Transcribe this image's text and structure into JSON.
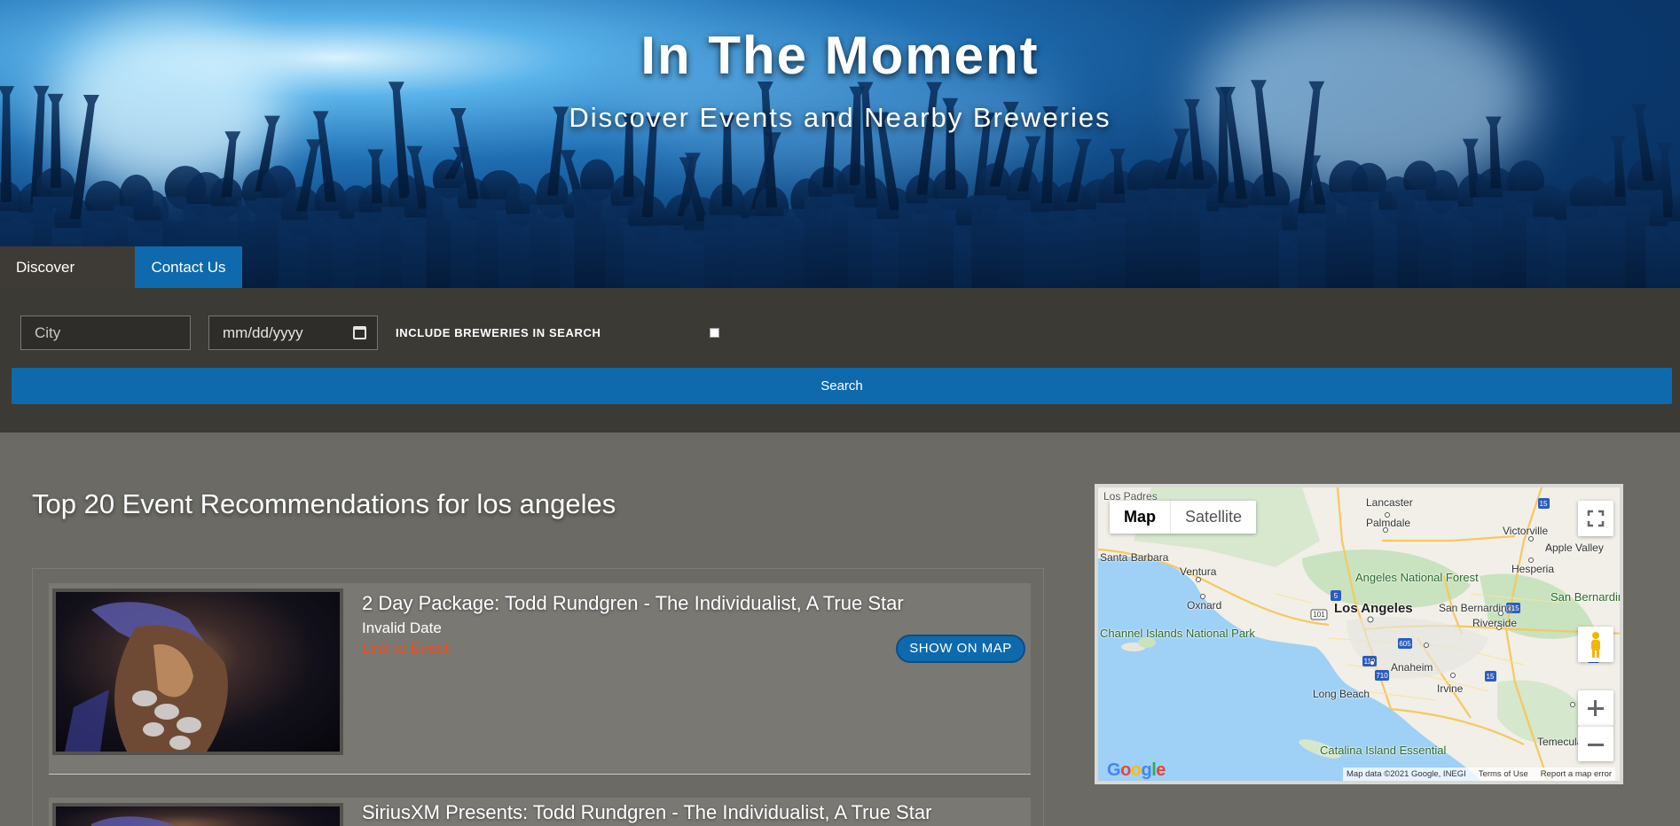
{
  "hero": {
    "title": "In The Moment",
    "subtitle": "Discover Events and Nearby Breweries"
  },
  "nav": {
    "tabs": [
      {
        "label": "Discover Events",
        "active": true
      },
      {
        "label": "Contact Us",
        "active": false
      }
    ]
  },
  "search": {
    "city_placeholder": "City",
    "date_placeholder": "mm/dd/yyyy",
    "include_breweries_label": "INCLUDE BREWERIES IN SEARCH",
    "include_breweries_checked": false,
    "button_label": "Search"
  },
  "results": {
    "heading": "Top 20 Event Recommendations for los angeles",
    "events": [
      {
        "title": "2 Day Package: Todd Rundgren - The Individualist, A True Star",
        "date": "Invalid Date",
        "link_label": "Link to Event",
        "map_button": "SHOW ON MAP"
      },
      {
        "title": "SiriusXM Presents: Todd Rundgren - The Individualist, A True Star",
        "date": "",
        "link_label": "",
        "map_button": ""
      }
    ]
  },
  "map": {
    "type_buttons": [
      "Map",
      "Satellite"
    ],
    "selected_type": "Map",
    "labels": {
      "lancaster": "Lancaster",
      "palmdale": "Palmdale",
      "victorville": "Victorville",
      "apple_valley": "Apple Valley",
      "hesperia": "Hesperia",
      "santa_barbara": "Santa Barbara",
      "ventura": "Ventura",
      "oxnard": "Oxnard",
      "angeles_nf": "Angeles National Forest",
      "los_angeles": "Los Angeles",
      "san_bernardino": "San Bernardino",
      "san_bernardino_nf": "San Bernardino National Forest",
      "riverside": "Riverside",
      "anaheim": "Anaheim",
      "long_beach": "Long Beach",
      "irvine": "Irvine",
      "temecula": "Temecula",
      "channel_islands": "Channel Islands National Park",
      "catalina": "Catalina Island Essential",
      "los_padres": "Los Padres"
    },
    "logo": "Google",
    "attribution": [
      "Map data ©2021 Google, INEGI",
      "Terms of Use",
      "Report a map error"
    ],
    "colors": {
      "water": "#9fd0f6",
      "land": "#f1efe8",
      "park": "#c9e2bf",
      "road": "#f6c85f"
    }
  }
}
